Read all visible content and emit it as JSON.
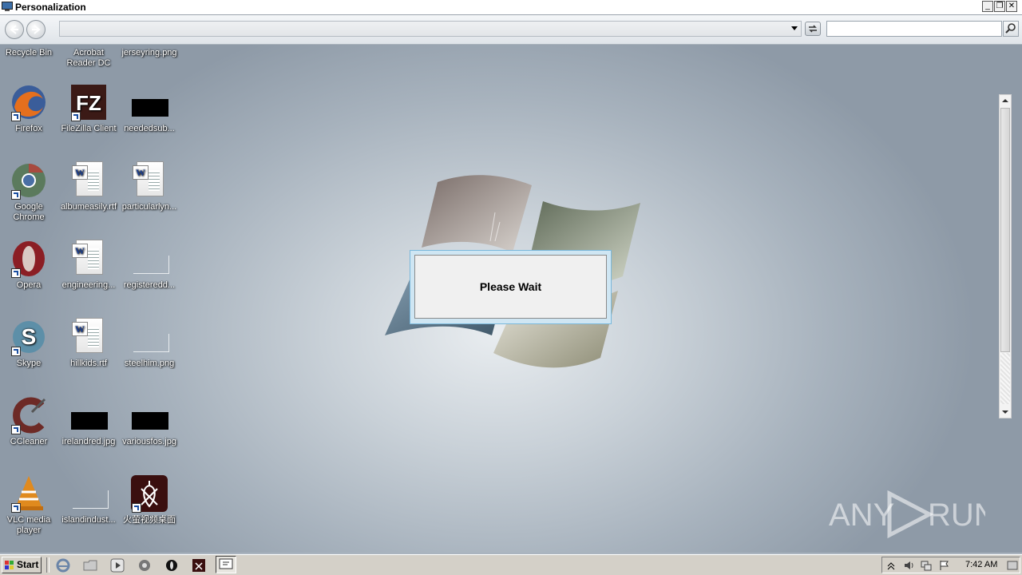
{
  "window": {
    "title": "Personalization",
    "controls": [
      "minimize",
      "restore",
      "close"
    ]
  },
  "toolbar": {
    "address_value": "",
    "search_value": ""
  },
  "desktop": {
    "icons": [
      {
        "label": "Recycle Bin",
        "icon": "recycle-bin-icon"
      },
      {
        "label": "Acrobat Reader DC",
        "icon": "acrobat-icon"
      },
      {
        "label": "jerseyring.png",
        "icon": "image-file-icon"
      },
      {
        "label": "Firefox",
        "icon": "firefox-icon"
      },
      {
        "label": "FileZilla Client",
        "icon": "filezilla-icon"
      },
      {
        "label": "neededsub...",
        "icon": "image-file-icon"
      },
      {
        "label": "Google Chrome",
        "icon": "chrome-icon"
      },
      {
        "label": "albumeasily.rtf",
        "icon": "rtf-document-icon"
      },
      {
        "label": "particularlyn...",
        "icon": "rtf-document-icon"
      },
      {
        "label": "Opera",
        "icon": "opera-icon"
      },
      {
        "label": "engineering...",
        "icon": "rtf-document-icon"
      },
      {
        "label": "registeredd...",
        "icon": "blank-file-icon"
      },
      {
        "label": "Skype",
        "icon": "skype-icon"
      },
      {
        "label": "hillkids.rtf",
        "icon": "rtf-document-icon"
      },
      {
        "label": "steelhim.png",
        "icon": "image-file-icon"
      },
      {
        "label": "CCleaner",
        "icon": "ccleaner-icon"
      },
      {
        "label": "irelandred.jpg",
        "icon": "image-file-icon"
      },
      {
        "label": "variousfos.jpg",
        "icon": "image-file-icon"
      },
      {
        "label": "VLC media player",
        "icon": "vlc-icon"
      },
      {
        "label": "islandindust...",
        "icon": "blank-file-icon"
      },
      {
        "label": "火萤视频桌面",
        "icon": "huoying-icon"
      }
    ]
  },
  "dialog": {
    "message": "Please Wait"
  },
  "watermark": {
    "text_left": "ANY",
    "text_right": "RUN"
  },
  "taskbar": {
    "start_label": "Start",
    "clock": "7:42 AM",
    "quick_launch": [
      "ie-icon",
      "folder-icon",
      "media-player-icon",
      "chrome-icon",
      "opera-icon",
      "huoying-icon",
      "active-window-icon"
    ]
  },
  "colors": {
    "dialog_border": "#7ab8dc",
    "dialog_bg": "#f0f0f0",
    "taskbar_bg": "#d4d0c8"
  }
}
